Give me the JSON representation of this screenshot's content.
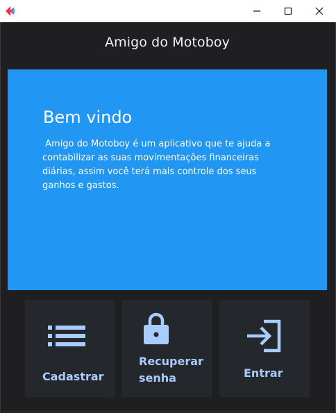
{
  "window": {
    "controls": [
      "minimize-icon",
      "maximize-icon",
      "close-icon"
    ]
  },
  "app": {
    "title": "Amigo do Motoboy"
  },
  "welcome": {
    "title": "Bem vindo",
    "text": " Amigo do Motoboy é um aplicativo que te ajuda a contabilizar as suas movimentações financeiras diárias, assim você terá mais controle dos seus ganhos e gastos."
  },
  "actions": [
    {
      "label": "Cadastrar",
      "icon": "list-icon"
    },
    {
      "label": "Recuperar senha",
      "icon": "lock-icon"
    },
    {
      "label": "Entrar",
      "icon": "login-icon"
    }
  ],
  "colors": {
    "background": "#1f1f22",
    "card": "#2196f3",
    "tile": "#24272c",
    "accent": "#a9ccff"
  }
}
